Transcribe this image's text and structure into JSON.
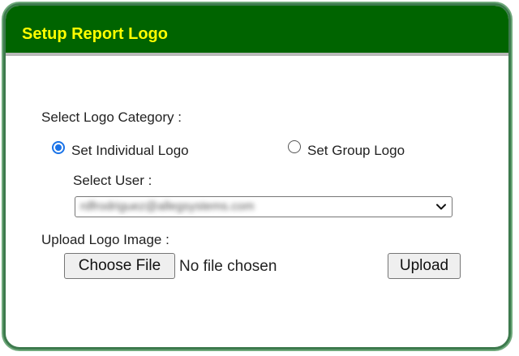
{
  "header": {
    "title": "Setup Report Logo"
  },
  "logo_category": {
    "label": "Select Logo Category :",
    "options": [
      {
        "label": "Set Individual Logo",
        "selected": true
      },
      {
        "label": "Set Group Logo",
        "selected": false
      }
    ]
  },
  "select_user": {
    "label": "Select User :",
    "value": "rdfrodriguez@allegsystems.com"
  },
  "upload": {
    "label": "Upload Logo Image :",
    "choose_file_label": "Choose File",
    "file_status": "No file chosen",
    "upload_label": "Upload"
  },
  "colors": {
    "header_bg": "#006400",
    "header_text": "#ffff00",
    "frame_border": "#3d7a4d",
    "radio_accent": "#1a73e8"
  },
  "icons": {
    "select_arrow": "chevron-down-icon"
  }
}
